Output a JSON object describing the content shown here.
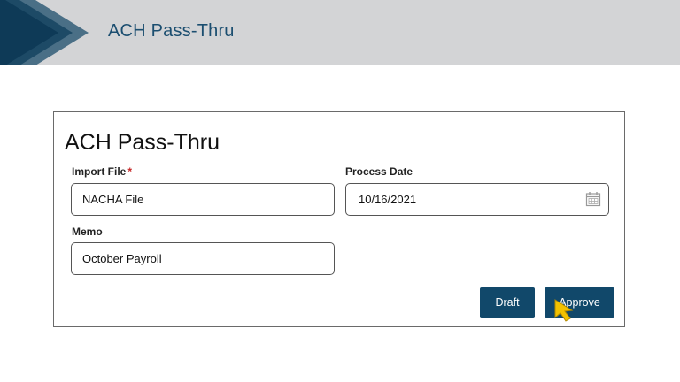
{
  "header": {
    "title": "ACH Pass-Thru"
  },
  "form": {
    "title": "ACH Pass-Thru",
    "import_file": {
      "label": "Import File",
      "required_mark": "*",
      "value": "NACHA File"
    },
    "process_date": {
      "label": "Process Date",
      "value": "10/16/2021"
    },
    "memo": {
      "label": "Memo",
      "value": "October Payroll"
    },
    "buttons": {
      "draft": "Draft",
      "approve": "Approve"
    }
  },
  "icons": {
    "calendar": "calendar-icon",
    "cursor": "pointer-cursor-icon"
  },
  "colors": {
    "banner_bg": "#d3d4d6",
    "brand_dark": "#0e3a57",
    "button_bg": "#11486a",
    "title_text": "#1b4e70",
    "cursor_yellow": "#f2c200"
  }
}
